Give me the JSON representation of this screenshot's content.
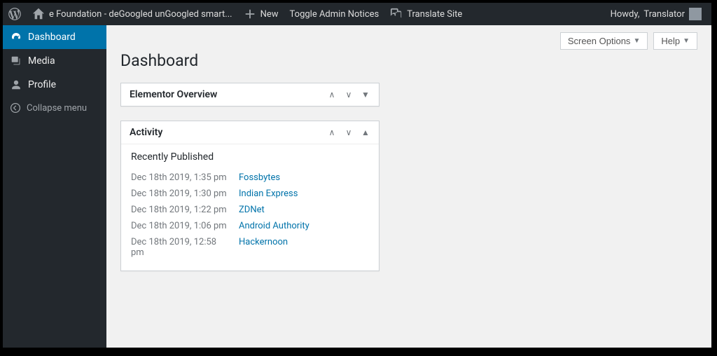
{
  "adminbar": {
    "site_title": "e Foundation - deGoogled unGoogled smart...",
    "new_label": "New",
    "toggle_notices": "Toggle Admin Notices",
    "translate_site": "Translate Site",
    "howdy_prefix": "Howdy,",
    "user_display_name": "Translator"
  },
  "sidebar": {
    "items": [
      {
        "label": "Dashboard",
        "current": true
      },
      {
        "label": "Media",
        "current": false
      },
      {
        "label": "Profile",
        "current": false
      }
    ],
    "collapse_label": "Collapse menu"
  },
  "top_buttons": {
    "screen_options": "Screen Options",
    "help": "Help"
  },
  "page_title": "Dashboard",
  "metaboxes": {
    "elementor": {
      "title": "Elementor Overview"
    },
    "activity": {
      "title": "Activity",
      "section": "Recently Published",
      "items": [
        {
          "when": "Dec 18th 2019, 1:35 pm",
          "what": "Fossbytes"
        },
        {
          "when": "Dec 18th 2019, 1:30 pm",
          "what": "Indian Express"
        },
        {
          "when": "Dec 18th 2019, 1:22 pm",
          "what": "ZDNet"
        },
        {
          "when": "Dec 18th 2019, 1:06 pm",
          "what": "Android Authority"
        },
        {
          "when": "Dec 18th 2019, 12:58 pm",
          "what": "Hackernoon"
        }
      ]
    }
  }
}
